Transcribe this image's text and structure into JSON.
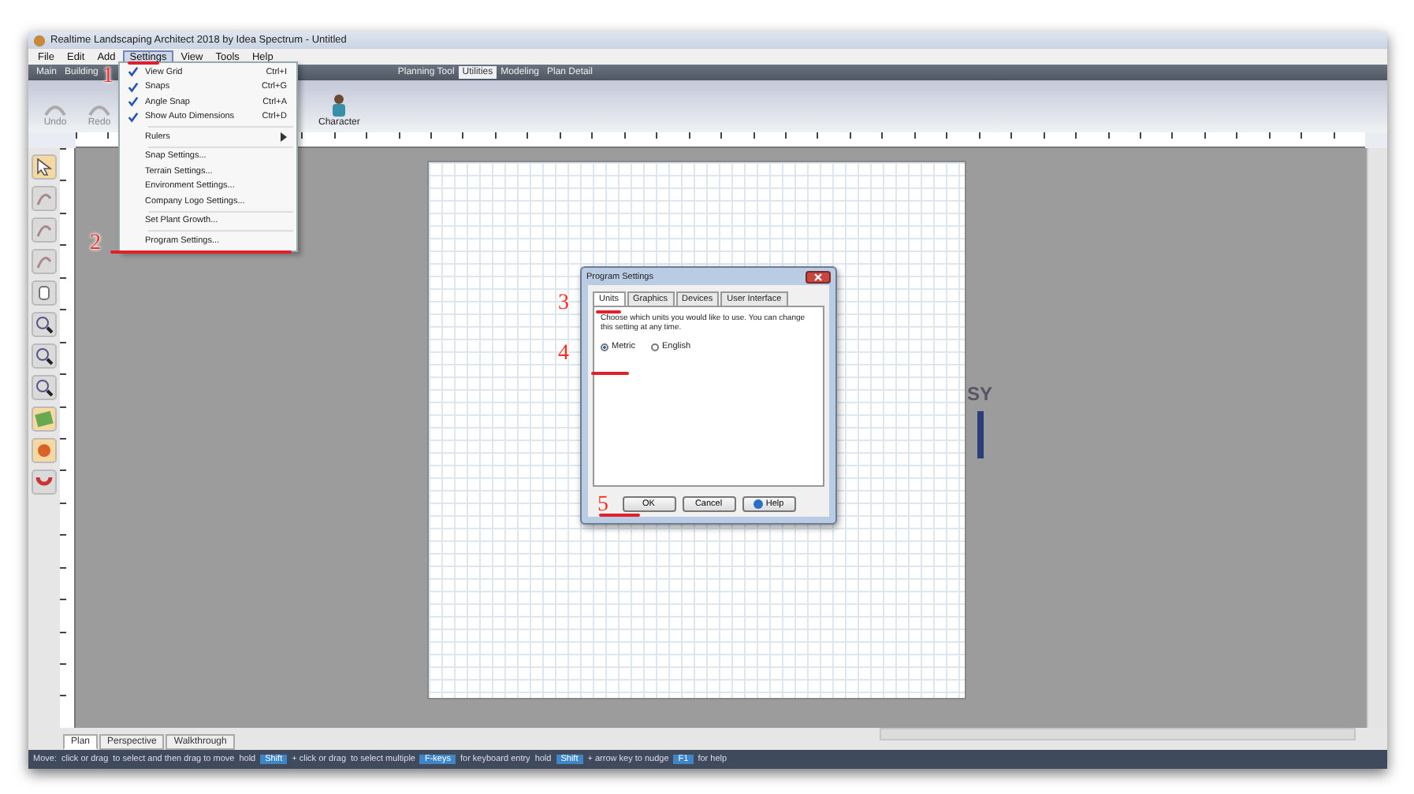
{
  "window": {
    "title": "Realtime Landscaping Architect 2018 by Idea Spectrum - Untitled"
  },
  "menu_bar": [
    {
      "label": "File",
      "selected": false
    },
    {
      "label": "Edit",
      "selected": false
    },
    {
      "label": "Add",
      "selected": false
    },
    {
      "label": "Settings",
      "selected": true
    },
    {
      "label": "View",
      "selected": false
    },
    {
      "label": "Tools",
      "selected": false
    },
    {
      "label": "Help",
      "selected": false
    }
  ],
  "ribbon_tabs": [
    {
      "label": "Main",
      "selected": false
    },
    {
      "label": "Building",
      "selected": false
    },
    {
      "label": "Planning Tool",
      "selected": false
    },
    {
      "label": "Utilities",
      "selected": true
    },
    {
      "label": "Modeling",
      "selected": false
    },
    {
      "label": "Plan Detail",
      "selected": false
    }
  ],
  "ribbon_buttons": [
    {
      "label": "Undo",
      "kind": "undo"
    },
    {
      "label": "Redo",
      "kind": "redo"
    },
    {
      "label": "Character",
      "kind": "character"
    }
  ],
  "settings_menu": [
    {
      "kind": "check",
      "label": "View Grid",
      "shortcut": "Ctrl+I",
      "checked": true
    },
    {
      "kind": "check",
      "label": "Snaps",
      "shortcut": "Ctrl+G",
      "checked": true
    },
    {
      "kind": "check",
      "label": "Angle Snap",
      "shortcut": "Ctrl+A",
      "checked": true
    },
    {
      "kind": "check",
      "label": "Show Auto Dimensions",
      "shortcut": "Ctrl+D",
      "checked": true
    },
    {
      "kind": "submenu",
      "label": "Rulers"
    },
    {
      "kind": "item",
      "label": "Snap Settings..."
    },
    {
      "kind": "item",
      "label": "Terrain Settings..."
    },
    {
      "kind": "item",
      "label": "Environment Settings..."
    },
    {
      "kind": "item",
      "label": "Company Logo Settings..."
    },
    {
      "kind": "item",
      "label": "Set Plant Growth..."
    },
    {
      "kind": "item",
      "label": "Program Settings..."
    }
  ],
  "dialog": {
    "title": "Program Settings",
    "tabs": [
      {
        "label": "Units",
        "selected": true
      },
      {
        "label": "Graphics",
        "selected": false
      },
      {
        "label": "Devices",
        "selected": false
      },
      {
        "label": "User Interface",
        "selected": false
      }
    ],
    "description": "Choose which units you would like to use. You can change this setting at any time.",
    "options": [
      {
        "label": "Metric",
        "selected": true
      },
      {
        "label": "English",
        "selected": false
      }
    ],
    "buttons": [
      {
        "label": "OK",
        "kind": "ok"
      },
      {
        "label": "Cancel",
        "kind": "cancel"
      },
      {
        "label": "Help",
        "kind": "help"
      }
    ]
  },
  "canvas": {
    "logo_text": "SY"
  },
  "view_tabs": [
    {
      "label": "Plan",
      "selected": true
    },
    {
      "label": "Perspective",
      "selected": false
    },
    {
      "label": "Walkthrough",
      "selected": false
    }
  ],
  "status_bar": [
    {
      "kind": "text",
      "label": "Move:"
    },
    {
      "kind": "text",
      "label": "click or drag"
    },
    {
      "kind": "text",
      "label": "to select and then drag to move"
    },
    {
      "kind": "text",
      "label": "hold"
    },
    {
      "kind": "key",
      "label": "Shift"
    },
    {
      "kind": "text",
      "label": "+ click or drag"
    },
    {
      "kind": "text",
      "label": "to select multiple"
    },
    {
      "kind": "key",
      "label": "F-keys"
    },
    {
      "kind": "text",
      "label": "for keyboard entry"
    },
    {
      "kind": "text",
      "label": "hold"
    },
    {
      "kind": "key",
      "label": "Shift"
    },
    {
      "kind": "text",
      "label": "+ arrow key to nudge"
    },
    {
      "kind": "key",
      "label": "F1"
    },
    {
      "kind": "text",
      "label": "for help"
    }
  ],
  "annotations": [
    {
      "number": "1"
    },
    {
      "number": "2"
    },
    {
      "number": "3"
    },
    {
      "number": "4"
    },
    {
      "number": "5"
    }
  ]
}
